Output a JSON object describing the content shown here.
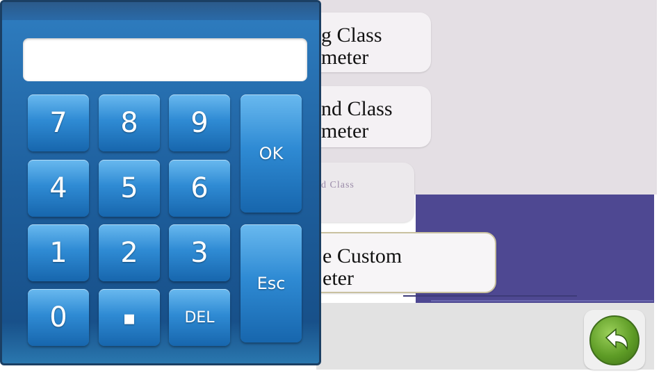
{
  "keypad": {
    "display_value": "",
    "keys": {
      "k7": "7",
      "k8": "8",
      "k9": "9",
      "k4": "4",
      "k5": "5",
      "k6": "6",
      "k1": "1",
      "k2": "2",
      "k3": "3",
      "k0": "0",
      "dot": "▪",
      "del": "DEL",
      "ok": "OK",
      "esc": "Esc"
    }
  },
  "background": {
    "buttons": [
      {
        "line1": "g Class",
        "line2": "meter"
      },
      {
        "line1": "nd Class",
        "line2": "meter"
      },
      {
        "line1": "d Class",
        "line2": ""
      },
      {
        "line1": "e Custom",
        "line2": "eter"
      }
    ],
    "back_icon": "back-arrow-icon"
  },
  "colors": {
    "keypad_blue": "#1e5f9d",
    "key_blue": "#2f8bd4",
    "purple_band": "#4e4892",
    "back_green": "#5e9c26"
  }
}
